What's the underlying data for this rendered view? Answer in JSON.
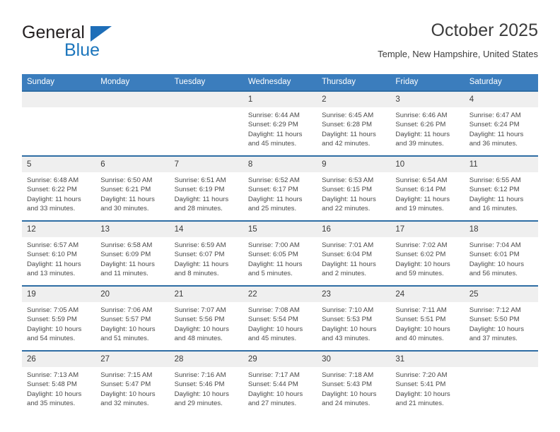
{
  "brand": {
    "name_primary": "General",
    "name_secondary": "Blue",
    "accent_color": "#1b75bc",
    "triangle_color": "#1e6eb8"
  },
  "header": {
    "title": "October 2025",
    "subtitle": "Temple, New Hampshire, United States"
  },
  "theme": {
    "header_row_bg": "#3b7dbd",
    "week_divider": "#2e6da4",
    "daynum_bg": "#efefef",
    "text": "#4a4a4a"
  },
  "labels": {
    "sunrise": "Sunrise:",
    "sunset": "Sunset:",
    "daylight": "Daylight:"
  },
  "calendar": {
    "weekdays": [
      "Sunday",
      "Monday",
      "Tuesday",
      "Wednesday",
      "Thursday",
      "Friday",
      "Saturday"
    ],
    "weeks": [
      [
        {
          "day": "",
          "empty": true
        },
        {
          "day": "",
          "empty": true
        },
        {
          "day": "",
          "empty": true
        },
        {
          "day": "1",
          "sunrise": "Sunrise: 6:44 AM",
          "sunset": "Sunset: 6:29 PM",
          "daylight": "Daylight: 11 hours and 45 minutes."
        },
        {
          "day": "2",
          "sunrise": "Sunrise: 6:45 AM",
          "sunset": "Sunset: 6:28 PM",
          "daylight": "Daylight: 11 hours and 42 minutes."
        },
        {
          "day": "3",
          "sunrise": "Sunrise: 6:46 AM",
          "sunset": "Sunset: 6:26 PM",
          "daylight": "Daylight: 11 hours and 39 minutes."
        },
        {
          "day": "4",
          "sunrise": "Sunrise: 6:47 AM",
          "sunset": "Sunset: 6:24 PM",
          "daylight": "Daylight: 11 hours and 36 minutes."
        }
      ],
      [
        {
          "day": "5",
          "sunrise": "Sunrise: 6:48 AM",
          "sunset": "Sunset: 6:22 PM",
          "daylight": "Daylight: 11 hours and 33 minutes."
        },
        {
          "day": "6",
          "sunrise": "Sunrise: 6:50 AM",
          "sunset": "Sunset: 6:21 PM",
          "daylight": "Daylight: 11 hours and 30 minutes."
        },
        {
          "day": "7",
          "sunrise": "Sunrise: 6:51 AM",
          "sunset": "Sunset: 6:19 PM",
          "daylight": "Daylight: 11 hours and 28 minutes."
        },
        {
          "day": "8",
          "sunrise": "Sunrise: 6:52 AM",
          "sunset": "Sunset: 6:17 PM",
          "daylight": "Daylight: 11 hours and 25 minutes."
        },
        {
          "day": "9",
          "sunrise": "Sunrise: 6:53 AM",
          "sunset": "Sunset: 6:15 PM",
          "daylight": "Daylight: 11 hours and 22 minutes."
        },
        {
          "day": "10",
          "sunrise": "Sunrise: 6:54 AM",
          "sunset": "Sunset: 6:14 PM",
          "daylight": "Daylight: 11 hours and 19 minutes."
        },
        {
          "day": "11",
          "sunrise": "Sunrise: 6:55 AM",
          "sunset": "Sunset: 6:12 PM",
          "daylight": "Daylight: 11 hours and 16 minutes."
        }
      ],
      [
        {
          "day": "12",
          "sunrise": "Sunrise: 6:57 AM",
          "sunset": "Sunset: 6:10 PM",
          "daylight": "Daylight: 11 hours and 13 minutes."
        },
        {
          "day": "13",
          "sunrise": "Sunrise: 6:58 AM",
          "sunset": "Sunset: 6:09 PM",
          "daylight": "Daylight: 11 hours and 11 minutes."
        },
        {
          "day": "14",
          "sunrise": "Sunrise: 6:59 AM",
          "sunset": "Sunset: 6:07 PM",
          "daylight": "Daylight: 11 hours and 8 minutes."
        },
        {
          "day": "15",
          "sunrise": "Sunrise: 7:00 AM",
          "sunset": "Sunset: 6:05 PM",
          "daylight": "Daylight: 11 hours and 5 minutes."
        },
        {
          "day": "16",
          "sunrise": "Sunrise: 7:01 AM",
          "sunset": "Sunset: 6:04 PM",
          "daylight": "Daylight: 11 hours and 2 minutes."
        },
        {
          "day": "17",
          "sunrise": "Sunrise: 7:02 AM",
          "sunset": "Sunset: 6:02 PM",
          "daylight": "Daylight: 10 hours and 59 minutes."
        },
        {
          "day": "18",
          "sunrise": "Sunrise: 7:04 AM",
          "sunset": "Sunset: 6:01 PM",
          "daylight": "Daylight: 10 hours and 56 minutes."
        }
      ],
      [
        {
          "day": "19",
          "sunrise": "Sunrise: 7:05 AM",
          "sunset": "Sunset: 5:59 PM",
          "daylight": "Daylight: 10 hours and 54 minutes."
        },
        {
          "day": "20",
          "sunrise": "Sunrise: 7:06 AM",
          "sunset": "Sunset: 5:57 PM",
          "daylight": "Daylight: 10 hours and 51 minutes."
        },
        {
          "day": "21",
          "sunrise": "Sunrise: 7:07 AM",
          "sunset": "Sunset: 5:56 PM",
          "daylight": "Daylight: 10 hours and 48 minutes."
        },
        {
          "day": "22",
          "sunrise": "Sunrise: 7:08 AM",
          "sunset": "Sunset: 5:54 PM",
          "daylight": "Daylight: 10 hours and 45 minutes."
        },
        {
          "day": "23",
          "sunrise": "Sunrise: 7:10 AM",
          "sunset": "Sunset: 5:53 PM",
          "daylight": "Daylight: 10 hours and 43 minutes."
        },
        {
          "day": "24",
          "sunrise": "Sunrise: 7:11 AM",
          "sunset": "Sunset: 5:51 PM",
          "daylight": "Daylight: 10 hours and 40 minutes."
        },
        {
          "day": "25",
          "sunrise": "Sunrise: 7:12 AM",
          "sunset": "Sunset: 5:50 PM",
          "daylight": "Daylight: 10 hours and 37 minutes."
        }
      ],
      [
        {
          "day": "26",
          "sunrise": "Sunrise: 7:13 AM",
          "sunset": "Sunset: 5:48 PM",
          "daylight": "Daylight: 10 hours and 35 minutes."
        },
        {
          "day": "27",
          "sunrise": "Sunrise: 7:15 AM",
          "sunset": "Sunset: 5:47 PM",
          "daylight": "Daylight: 10 hours and 32 minutes."
        },
        {
          "day": "28",
          "sunrise": "Sunrise: 7:16 AM",
          "sunset": "Sunset: 5:46 PM",
          "daylight": "Daylight: 10 hours and 29 minutes."
        },
        {
          "day": "29",
          "sunrise": "Sunrise: 7:17 AM",
          "sunset": "Sunset: 5:44 PM",
          "daylight": "Daylight: 10 hours and 27 minutes."
        },
        {
          "day": "30",
          "sunrise": "Sunrise: 7:18 AM",
          "sunset": "Sunset: 5:43 PM",
          "daylight": "Daylight: 10 hours and 24 minutes."
        },
        {
          "day": "31",
          "sunrise": "Sunrise: 7:20 AM",
          "sunset": "Sunset: 5:41 PM",
          "daylight": "Daylight: 10 hours and 21 minutes."
        },
        {
          "day": "",
          "empty": true
        }
      ]
    ]
  }
}
